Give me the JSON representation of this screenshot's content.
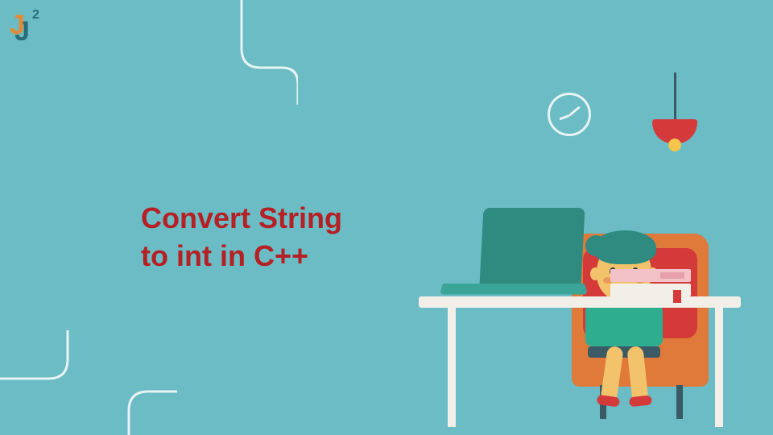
{
  "logo": {
    "glyph1": "J",
    "glyph2": "J",
    "super": "2"
  },
  "title": {
    "line1": "Convert String",
    "line2": "to int in C++"
  },
  "colors": {
    "background": "#6bbcc4",
    "title": "#b52025",
    "accent_orange": "#e58a2f",
    "accent_red": "#d43a3a",
    "accent_teal": "#2f8a80"
  }
}
